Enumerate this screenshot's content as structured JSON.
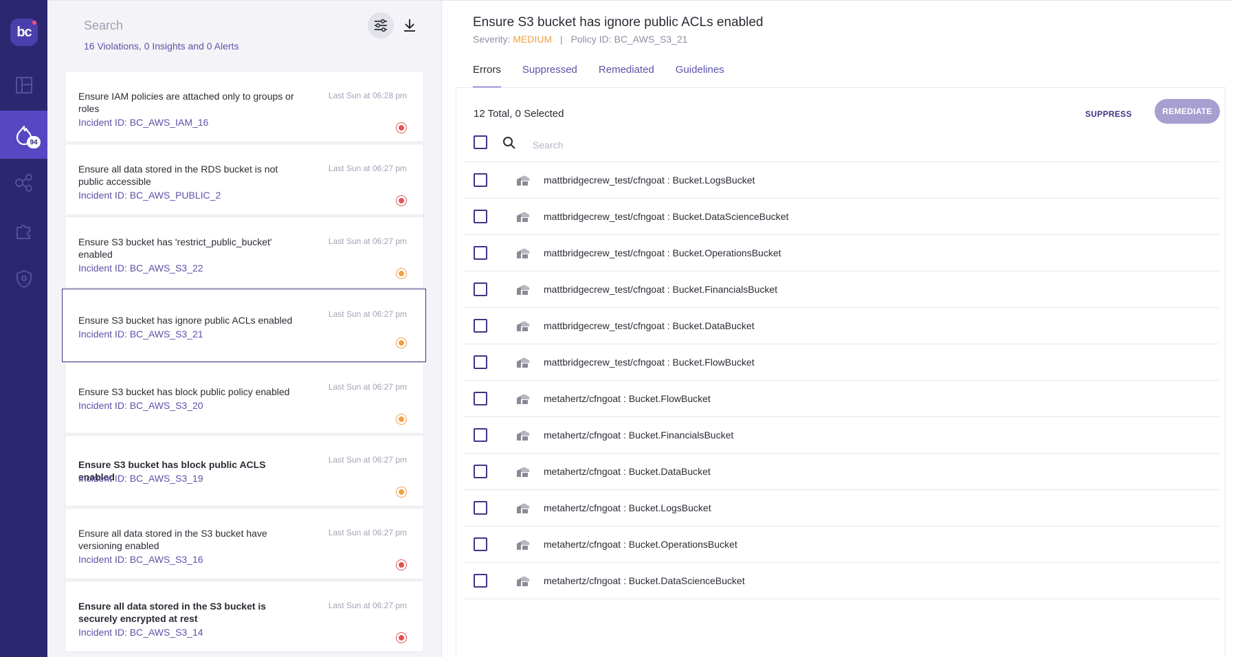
{
  "nav": {
    "logo_text": "bc",
    "incidents_badge": "94",
    "items": [
      "dashboard-icon",
      "incidents-icon",
      "integrations-icon",
      "policies-icon",
      "shield-icon"
    ]
  },
  "incidents_panel": {
    "search_placeholder": "Search",
    "summary": "16 Violations, 0 Insights and 0 Alerts",
    "items": [
      {
        "title": "Ensure IAM policies are attached only to groups or roles",
        "incident": "Incident ID: BC_AWS_IAM_16",
        "time": "Last Sun at 06:28 pm",
        "severity_color": "#e05555",
        "bold": false
      },
      {
        "title": "Ensure all data stored in the RDS bucket is not public accessible",
        "incident": "Incident ID: BC_AWS_PUBLIC_2",
        "time": "Last Sun at 06:27 pm",
        "severity_color": "#e05555",
        "bold": false
      },
      {
        "title": "Ensure S3 bucket has 'restrict_public_bucket' enabled",
        "incident": "Incident ID: BC_AWS_S3_22",
        "time": "Last Sun at 06:27 pm",
        "severity_color": "#f0a146",
        "bold": false
      },
      {
        "title": "Ensure S3 bucket has ignore public ACLs enabled",
        "incident": "Incident ID: BC_AWS_S3_21",
        "time": "Last Sun at 06:27 pm",
        "severity_color": "#f0a146",
        "bold": false,
        "selected": true
      },
      {
        "title": "Ensure S3 bucket has block public policy enabled",
        "incident": "Incident ID: BC_AWS_S3_20",
        "time": "Last Sun at 06:27 pm",
        "severity_color": "#f0a146",
        "bold": false
      },
      {
        "title": "Ensure S3 bucket has block public ACLS enabled",
        "incident": "Incident ID: BC_AWS_S3_19",
        "time": "Last Sun at 06:27 pm",
        "severity_color": "#f0a146",
        "bold": true
      },
      {
        "title": "Ensure all data stored in the S3 bucket have versioning enabled",
        "incident": "Incident ID: BC_AWS_S3_16",
        "time": "Last Sun at 06:27 pm",
        "severity_color": "#e05555",
        "bold": false
      },
      {
        "title": "Ensure all data stored in the S3 bucket is securely encrypted at rest",
        "incident": "Incident ID: BC_AWS_S3_14",
        "time": "Last Sun at 06:27 pm",
        "severity_color": "#e05555",
        "bold": true
      }
    ]
  },
  "policy": {
    "title": "Ensure S3 bucket has ignore public ACLs enabled",
    "severity_label": "Severity:",
    "severity_value": "MEDIUM",
    "separator": "|",
    "policy_id": "Policy ID: BC_AWS_S3_21",
    "tabs": [
      "Errors",
      "Suppressed",
      "Remediated",
      "Guidelines"
    ],
    "active_tab": "Errors"
  },
  "errors": {
    "totals": "12 Total, 0 Selected",
    "suppress_label": "SUPPRESS",
    "remediate_label": "REMEDIATE",
    "search_placeholder": "Search",
    "resources": [
      "mattbridgecrew_test/cfngoat : Bucket.LogsBucket",
      "mattbridgecrew_test/cfngoat : Bucket.DataScienceBucket",
      "mattbridgecrew_test/cfngoat : Bucket.OperationsBucket",
      "mattbridgecrew_test/cfngoat : Bucket.FinancialsBucket",
      "mattbridgecrew_test/cfngoat : Bucket.DataBucket",
      "mattbridgecrew_test/cfngoat : Bucket.FlowBucket",
      "metahertz/cfngoat : Bucket.FlowBucket",
      "metahertz/cfngoat : Bucket.FinancialsBucket",
      "metahertz/cfngoat : Bucket.DataBucket",
      "metahertz/cfngoat : Bucket.LogsBucket",
      "metahertz/cfngoat : Bucket.OperationsBucket",
      "metahertz/cfngoat : Bucket.DataScienceBucket"
    ]
  }
}
